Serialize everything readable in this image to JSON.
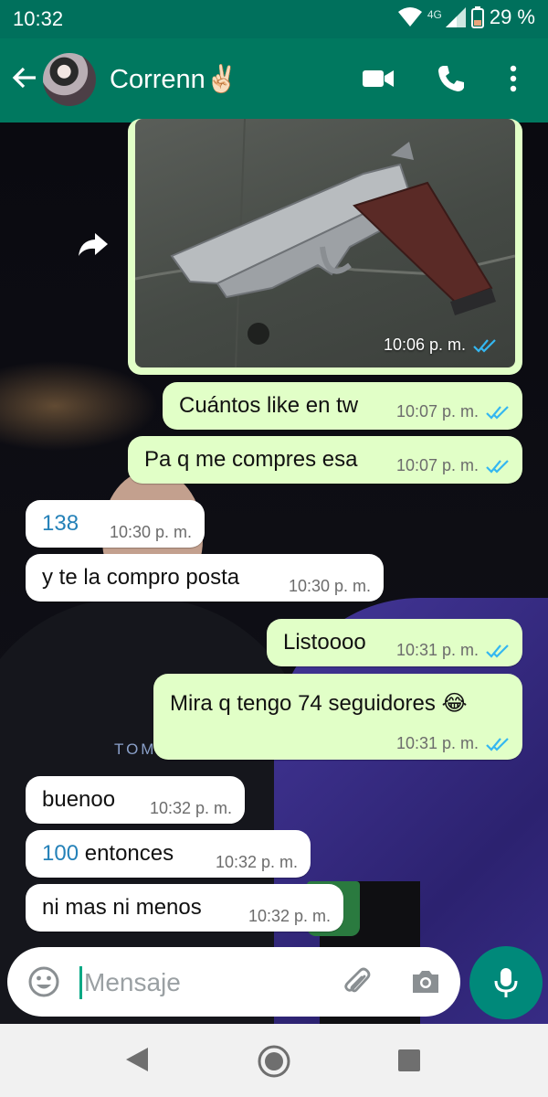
{
  "status_bar": {
    "time": "10:32",
    "network": "4G",
    "battery": "29 %"
  },
  "header": {
    "contact_name": "Correnn✌🏻"
  },
  "wallpaper": {
    "shirt_text": "TOMMY HILFIGER"
  },
  "messages": [
    {
      "type": "image",
      "direction": "outgoing",
      "time": "10:06 p. m.",
      "status": "read"
    },
    {
      "direction": "outgoing",
      "text": "Cuántos like en tw",
      "time": "10:07 p. m.",
      "status": "read"
    },
    {
      "direction": "outgoing",
      "text": "Pa q me compres esa",
      "time": "10:07 p. m.",
      "status": "read"
    },
    {
      "direction": "incoming",
      "text": "138",
      "time": "10:30 p. m."
    },
    {
      "direction": "incoming",
      "text": "y te la compro posta",
      "time": "10:30 p. m."
    },
    {
      "direction": "outgoing",
      "text": "Listoooo",
      "time": "10:31 p. m.",
      "status": "read"
    },
    {
      "direction": "outgoing",
      "text": "Mira q tengo 74 seguidores 😂",
      "time": "10:31 p. m.",
      "status": "read"
    },
    {
      "direction": "incoming",
      "text": "buenoo",
      "time": "10:32 p. m."
    },
    {
      "direction": "incoming",
      "text_number": "100",
      "text_rest": " entonces",
      "time": "10:32 p. m."
    },
    {
      "direction": "incoming",
      "text": "ni mas ni menos",
      "time": "10:32 p. m."
    }
  ],
  "composer": {
    "placeholder": "Mensaje"
  },
  "colors": {
    "header": "#00785f",
    "outgoing_bubble": "#e1ffc7",
    "incoming_bubble": "#ffffff",
    "read_ticks": "#34b7f1",
    "link": "#2481b8",
    "mic_button": "#00897a"
  },
  "icons": [
    "back-arrow-icon",
    "video-call-icon",
    "phone-icon",
    "more-vert-icon",
    "forward-icon",
    "emoji-icon",
    "attach-icon",
    "camera-icon",
    "mic-icon",
    "nav-back-icon",
    "nav-home-icon",
    "nav-recents-icon"
  ]
}
